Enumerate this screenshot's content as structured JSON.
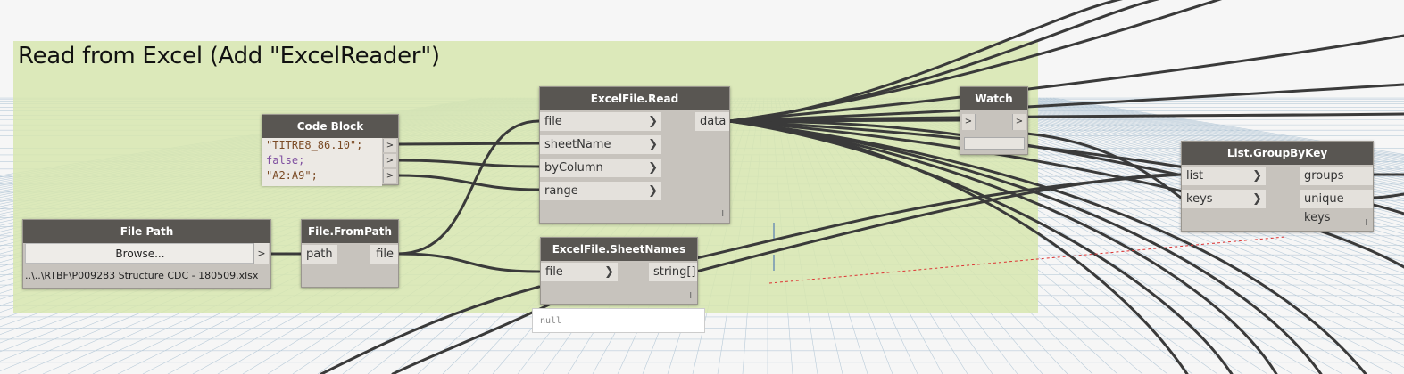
{
  "group": {
    "title": "Read from Excel (Add \"ExcelReader\")",
    "color": "#d7e6af"
  },
  "colors": {
    "node_header": "#595652",
    "node_body": "#c7c3bd",
    "wire": "#3a3a3a",
    "port": "#e4e1dc"
  },
  "nodes": {
    "code_block": {
      "title": "Code Block",
      "lines": [
        "\"TITRE8_86.10\";",
        "false;",
        "\"A2:A9\";"
      ],
      "outputs": [
        ">",
        ">",
        ">"
      ]
    },
    "file_path": {
      "title": "File Path",
      "button_label": "Browse...",
      "output": ">",
      "value": "..\\..\\RTBF\\P009283 Structure CDC - 180509.xlsx"
    },
    "file_from_path": {
      "title": "File.FromPath",
      "input": "path",
      "output": "file"
    },
    "excel_read": {
      "title": "ExcelFile.Read",
      "inputs": [
        "file",
        "sheetName",
        "byColumn",
        "range"
      ],
      "output": "data",
      "lacing": "l"
    },
    "excel_sheet_names": {
      "title": "ExcelFile.SheetNames",
      "input": "file",
      "output": "string[]",
      "lacing": "l",
      "preview": "null"
    },
    "watch": {
      "title": "Watch",
      "input": ">",
      "output": ">"
    },
    "group_by_key": {
      "title": "List.GroupByKey",
      "inputs": [
        "list",
        "keys"
      ],
      "outputs": [
        "groups",
        "unique keys"
      ],
      "lacing": "l"
    }
  }
}
